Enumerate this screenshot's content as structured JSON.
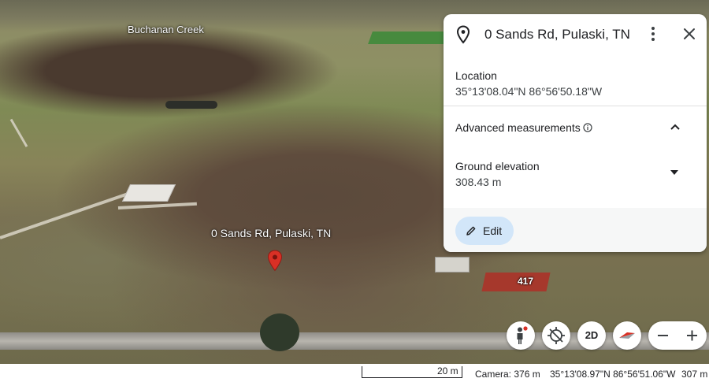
{
  "map": {
    "labels": {
      "creek": "Buchanan Creek",
      "place": "0 Sands Rd, Pulaski, TN",
      "house_number": "417"
    }
  },
  "panel": {
    "title": "0 Sands Rd, Pulaski, TN",
    "location_label": "Location",
    "location_value": "35°13'08.04\"N 86°56'50.18\"W",
    "advanced_label": "Advanced measurements",
    "ground_elevation_label": "Ground elevation",
    "ground_elevation_value": "308.43 m",
    "edit_label": "Edit"
  },
  "controls": {
    "mode_2d_label": "2D"
  },
  "status_bar": {
    "scale": "20 m",
    "camera": "Camera: 376 m",
    "coordinates": "35°13'08.97\"N 86°56'51.06\"W",
    "elevation": "307 m"
  },
  "colors": {
    "pin_red": "#d93025",
    "edit_button_bg": "#d2e6f9",
    "house_roof": "#a6382c"
  },
  "icons": [
    "pin-icon",
    "more-vert-icon",
    "close-icon",
    "info-icon",
    "chevron-up-icon",
    "dropdown-arrow-icon",
    "edit-pencil-icon",
    "pegman-icon",
    "recenter-icon",
    "compass-icon",
    "zoom-out-icon",
    "zoom-in-icon"
  ]
}
